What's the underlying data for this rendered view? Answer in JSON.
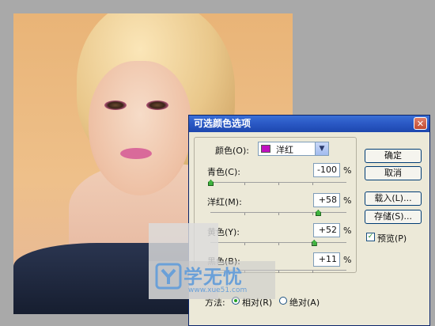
{
  "dialog": {
    "title": "可选颜色选项",
    "colors_label": "颜色(O):",
    "colors_value": "洋红",
    "swatch_color": "#c010c0",
    "sliders": [
      {
        "label": "青色(C):",
        "value": "-100",
        "unit": "%",
        "level": 0.0
      },
      {
        "label": "洋红(M):",
        "value": "+58",
        "unit": "%",
        "level": 0.79
      },
      {
        "label": "黄色(Y):",
        "value": "+52",
        "unit": "%",
        "level": 0.76
      },
      {
        "label": "黑色(B):",
        "value": "+11",
        "unit": "%",
        "level": 0.55
      }
    ],
    "buttons": {
      "ok": "确定",
      "cancel": "取消",
      "load": "载入(L)...",
      "save": "存储(S)..."
    },
    "preview_label": "预览(P)",
    "method_label": "方法:",
    "method_relative": "相对(R)",
    "method_absolute": "绝对(A)"
  },
  "watermark": {
    "brand": "学无忧",
    "url": "www.xue51.com",
    "color": "#6aa0d8"
  }
}
